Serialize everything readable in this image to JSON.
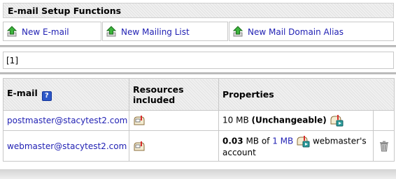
{
  "functions": {
    "title": "E-mail Setup Functions",
    "items": [
      {
        "label": "New E-mail",
        "icon": "new-arrow-icon"
      },
      {
        "label": "New Mailing List",
        "icon": "new-arrow-icon"
      },
      {
        "label": "New Mail Domain Alias",
        "icon": "new-arrow-icon"
      }
    ]
  },
  "pager": {
    "text": "[1]"
  },
  "table": {
    "headers": {
      "email": "E-mail",
      "resources": "Resources included",
      "properties": "Properties"
    },
    "rows": [
      {
        "email": "postmaster@stacytest2.com",
        "size": "10 MB",
        "note": "(Unchangeable)"
      },
      {
        "email": "webmaster@stacytest2.com",
        "used": "0.03",
        "used_unit": "MB of",
        "quota": "1 MB",
        "owner": "webmaster's account"
      }
    ]
  },
  "colors": {
    "link": "#1f1fb3",
    "border": "#c8c8c8",
    "header_bg": "#f0f0f0"
  }
}
